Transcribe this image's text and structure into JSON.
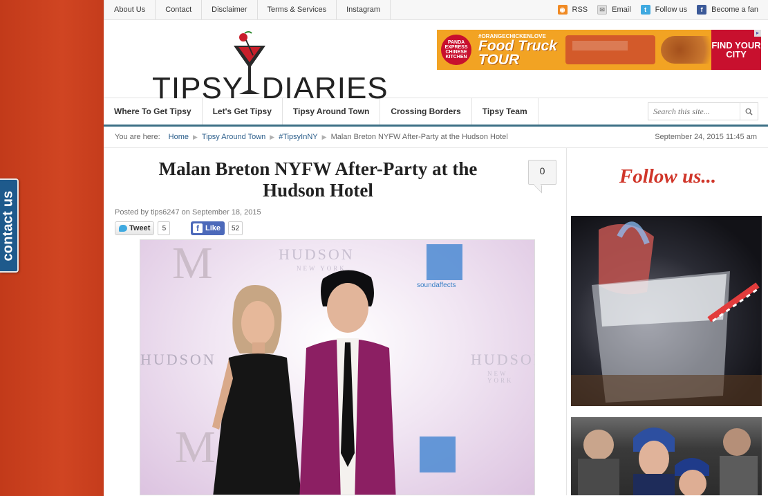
{
  "top_nav": [
    "About Us",
    "Contact",
    "Disclaimer",
    "Terms & Services",
    "Instagram"
  ],
  "social": {
    "rss": "RSS",
    "email": "Email",
    "follow": "Follow us",
    "fan": "Become a fan"
  },
  "contact_tab": "contact us",
  "logo": {
    "text": "TIPSY DIARIES"
  },
  "ad": {
    "brand": "PANDA EXPRESS CHINESE KITCHEN",
    "hashtag": "#ORANGECHICKENLOVE",
    "title_1": "Food Truck",
    "title_2": "TOUR",
    "cta": "FIND YOUR CITY"
  },
  "main_nav": [
    "Where To Get Tipsy",
    "Let's Get Tipsy",
    "Tipsy Around Town",
    "Crossing Borders",
    "Tipsy Team"
  ],
  "search": {
    "placeholder": "Search this site..."
  },
  "breadcrumb": {
    "prefix": "You are here:",
    "items": [
      "Home",
      "Tipsy Around Town",
      "#TipsyInNY"
    ],
    "current": "Malan Breton NYFW After-Party at the Hudson Hotel",
    "datetime": "September 24, 2015 11:45 am"
  },
  "post": {
    "title": "Malan Breton NYFW After-Party at the Hudson Hotel",
    "comments": "0",
    "byline_prefix": "Posted by",
    "author": "tips6247",
    "byline_on": "on",
    "date": "September 18, 2015",
    "tweet_label": "Tweet",
    "tweet_count": "5",
    "like_label": "Like",
    "like_count": "52"
  },
  "photo": {
    "wm_hudson": "HUDSON",
    "wm_newyork": "NEW YORK",
    "wm_sound": "soundaffects",
    "wm_m": "M"
  },
  "sidebar": {
    "follow_title": "Follow us..."
  },
  "colors": {
    "brand_red": "#d0362a",
    "left_band": "#c8401d",
    "nav_rule": "#3c6f85",
    "link": "#2a5d8a"
  }
}
